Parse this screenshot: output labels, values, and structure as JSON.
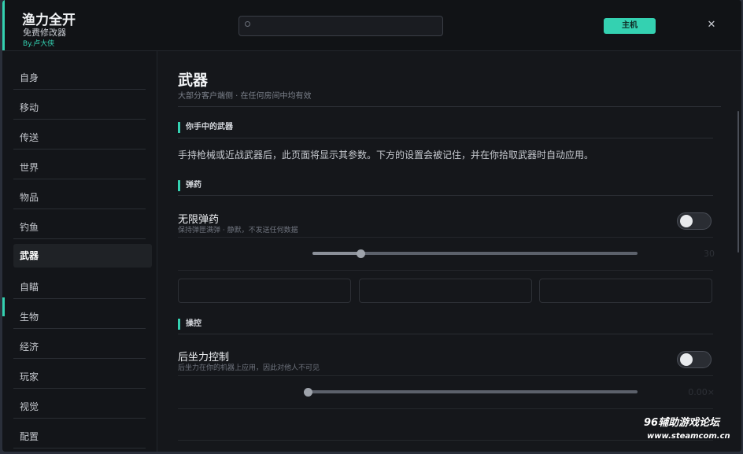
{
  "app": {
    "title": "渔力全开",
    "subtitle": "免费修改器",
    "by": "By.卢大侠",
    "host_label": "主机",
    "close_glyph": "✕"
  },
  "search": {
    "placeholder": ""
  },
  "sidebar": {
    "items": [
      {
        "label": "自身"
      },
      {
        "label": "移动"
      },
      {
        "label": "传送"
      },
      {
        "label": "世界"
      },
      {
        "label": "物品"
      },
      {
        "label": "钓鱼"
      },
      {
        "label": "武器"
      },
      {
        "label": "自瞄"
      },
      {
        "label": "生物"
      },
      {
        "label": "经济"
      },
      {
        "label": "玩家"
      },
      {
        "label": "视觉"
      },
      {
        "label": "配置"
      }
    ],
    "active_index": 6
  },
  "main": {
    "title": "武器",
    "subtitle": "大部分客户端侧 · 在任何房间中均有效",
    "section_hand": {
      "title": "你手中的武器",
      "description": "手持枪械或近战武器后，此页面将显示其参数。下方的设置会被记住，并在你拾取武器时自动应用。"
    },
    "section_ammo": {
      "title": "弹药",
      "infinite": {
        "title": "无限弹药",
        "subtitle": "保持弹匣满弹 · 静默，不发送任何数据",
        "enabled": false
      },
      "slider": {
        "value": 30,
        "value_label": "30",
        "fraction": 0.15
      }
    },
    "section_control": {
      "title": "操控",
      "recoil": {
        "title": "后坐力控制",
        "subtitle": "后坐力在你的机器上应用，因此对他人不可见",
        "enabled": false
      },
      "slider": {
        "value_label": "0.00×",
        "fraction": 0.0
      }
    }
  },
  "watermark": {
    "line1": "96辅助游戏论坛",
    "line2": "www.steamcom.cn"
  },
  "colors": {
    "accent": "#34d1b1",
    "background": "#15171b"
  },
  "icons": [
    "search-icon",
    "close-icon"
  ]
}
